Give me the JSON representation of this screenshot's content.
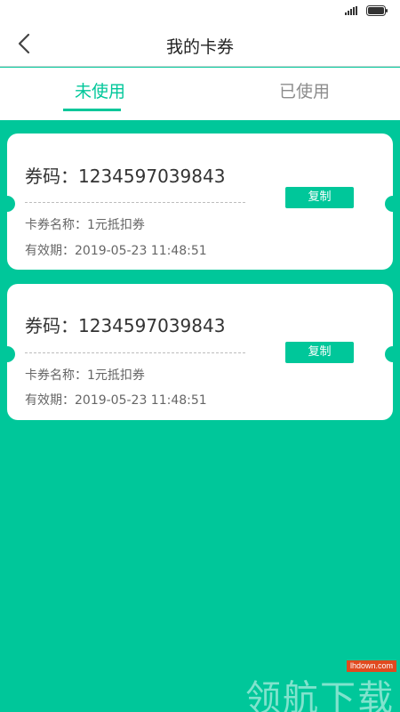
{
  "header": {
    "title": "我的卡券"
  },
  "tabs": [
    {
      "label": "未使用",
      "active": true
    },
    {
      "label": "已使用",
      "active": false
    }
  ],
  "coupons": [
    {
      "code_text": "券码：1234597039843",
      "name_text": "卡券名称：1元抵扣券",
      "expiry_text": "有效期：2019-05-23 11:48:51",
      "copy_label": "复制"
    },
    {
      "code_text": "券码：1234597039843",
      "name_text": "卡券名称：1元抵扣券",
      "expiry_text": "有效期：2019-05-23 11:48:51",
      "copy_label": "复制"
    }
  ],
  "watermark": {
    "url": "lhdown.com",
    "text": "领航下载"
  },
  "colors": {
    "accent": "#00c79a",
    "inactive_tab": "#8c8c8c",
    "watermark_badge": "#e04a1f"
  },
  "icons": {
    "back": "chevron-left-icon",
    "signal": "signal-icon",
    "battery": "battery-icon"
  }
}
